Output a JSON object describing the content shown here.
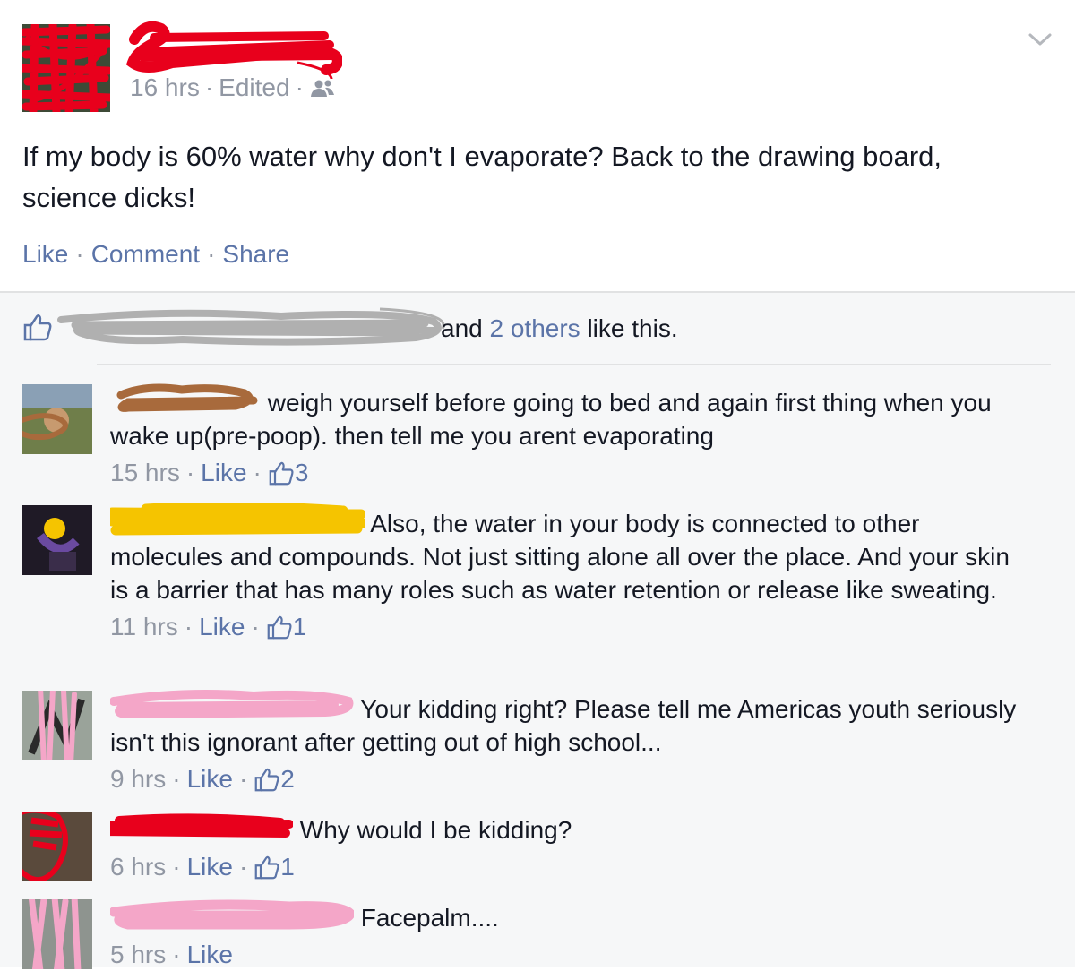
{
  "post": {
    "time": "16 hrs",
    "edited": "Edited",
    "text": "If my body is 60% water why don't I evaporate? Back to the drawing board, science dicks!",
    "actions": {
      "like": "Like",
      "comment": "Comment",
      "share": "Share"
    }
  },
  "likes": {
    "and": "and",
    "others_link": "2 others",
    "suffix": "like this."
  },
  "comments": [
    {
      "text": "weigh yourself before going to bed and again first thing when you wake up(pre-poop). then tell me you arent evaporating",
      "time": "15 hrs",
      "like": "Like",
      "count": "3"
    },
    {
      "text": "Also, the water in your body is connected to other molecules and compounds. Not just sitting alone all over the place. And your skin is a barrier that has many roles such as water retention or release like sweating.",
      "time": "11 hrs",
      "like": "Like",
      "count": "1"
    },
    {
      "text": "Your kidding right? Please tell me Americas youth seriously isn't this ignorant after getting out of high school...",
      "time": "9 hrs",
      "like": "Like",
      "count": "2"
    },
    {
      "text": "Why would I be kidding?",
      "time": "6 hrs",
      "like": "Like",
      "count": "1"
    },
    {
      "text": "Facepalm....",
      "time": "5 hrs",
      "like": "Like"
    }
  ],
  "colors": {
    "link_blue": "#5b74a8",
    "meta_gray": "#9197a3",
    "redaction_red": "#e8001c",
    "redaction_brown": "#a86a3c",
    "redaction_yellow": "#f5c400",
    "redaction_pink": "#f4a6c8",
    "redaction_gray": "#b0b0b0"
  },
  "icons": {
    "audience": "friends-icon",
    "menu": "chevron-down-icon",
    "like": "thumbs-up-icon"
  }
}
